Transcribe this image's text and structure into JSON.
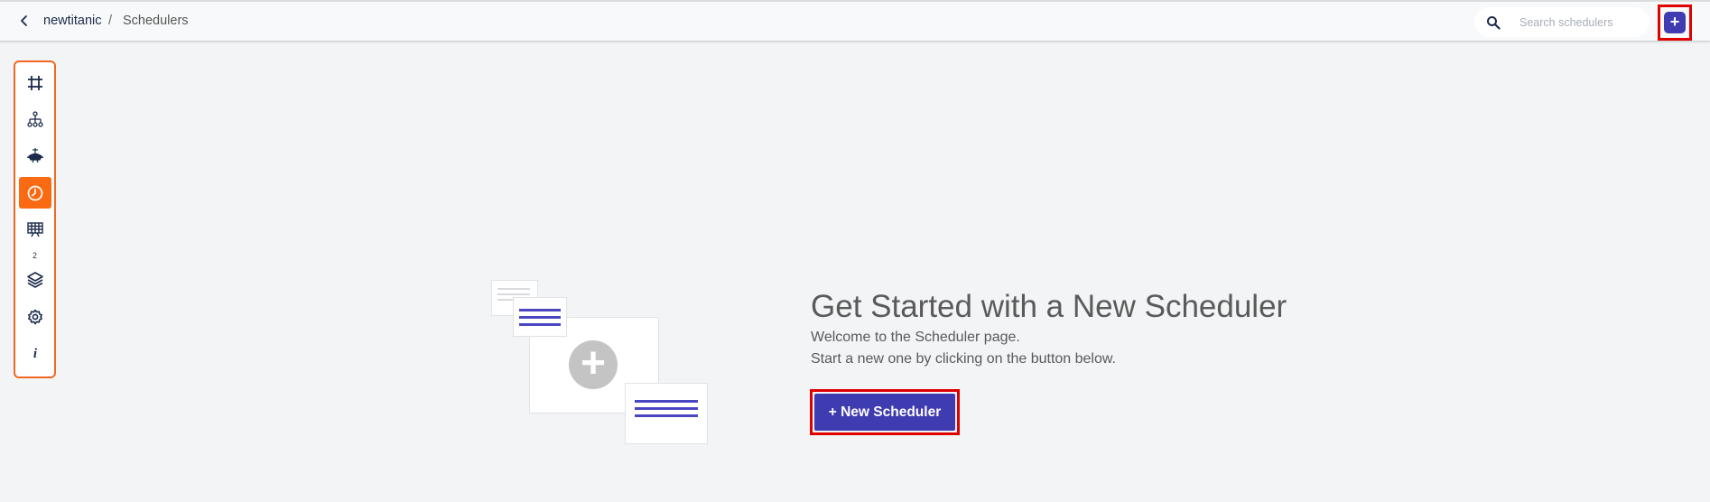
{
  "header": {
    "back_icon": "chevron-left-icon",
    "breadcrumb": {
      "project": "newtitanic",
      "separator": "/",
      "page": "Schedulers"
    },
    "search": {
      "placeholder": "Search schedulers",
      "value": "",
      "icon": "search-icon"
    },
    "add_button_label": "+"
  },
  "sidebar": {
    "items": [
      {
        "id": "canvas",
        "icon": "frame-icon",
        "active": false
      },
      {
        "id": "hierarchy",
        "icon": "hierarchy-icon",
        "active": false
      },
      {
        "id": "ml",
        "icon": "robot-icon",
        "active": false
      },
      {
        "id": "schedulers",
        "icon": "clock-icon",
        "active": true
      },
      {
        "id": "dashboards",
        "icon": "presentation-icon",
        "active": false,
        "badge": "2"
      },
      {
        "id": "layers",
        "icon": "layers-icon",
        "active": false
      },
      {
        "id": "settings",
        "icon": "gear-icon",
        "active": false
      },
      {
        "id": "info",
        "icon": "info-icon",
        "active": false,
        "glyph": "i"
      }
    ]
  },
  "main": {
    "title": "Get Started with a New Scheduler",
    "subtitle_line1": "Welcome to the Scheduler page.",
    "subtitle_line2": "Start a new one by clicking on the button below.",
    "new_button_label": "+ New Scheduler",
    "illustration_plus": "+"
  },
  "colors": {
    "accent": "#3f3bb0",
    "active_tool": "#fa6a12",
    "toolbar_border": "#f26722",
    "highlight_border": "#e00000",
    "background": "#f3f4f6"
  }
}
